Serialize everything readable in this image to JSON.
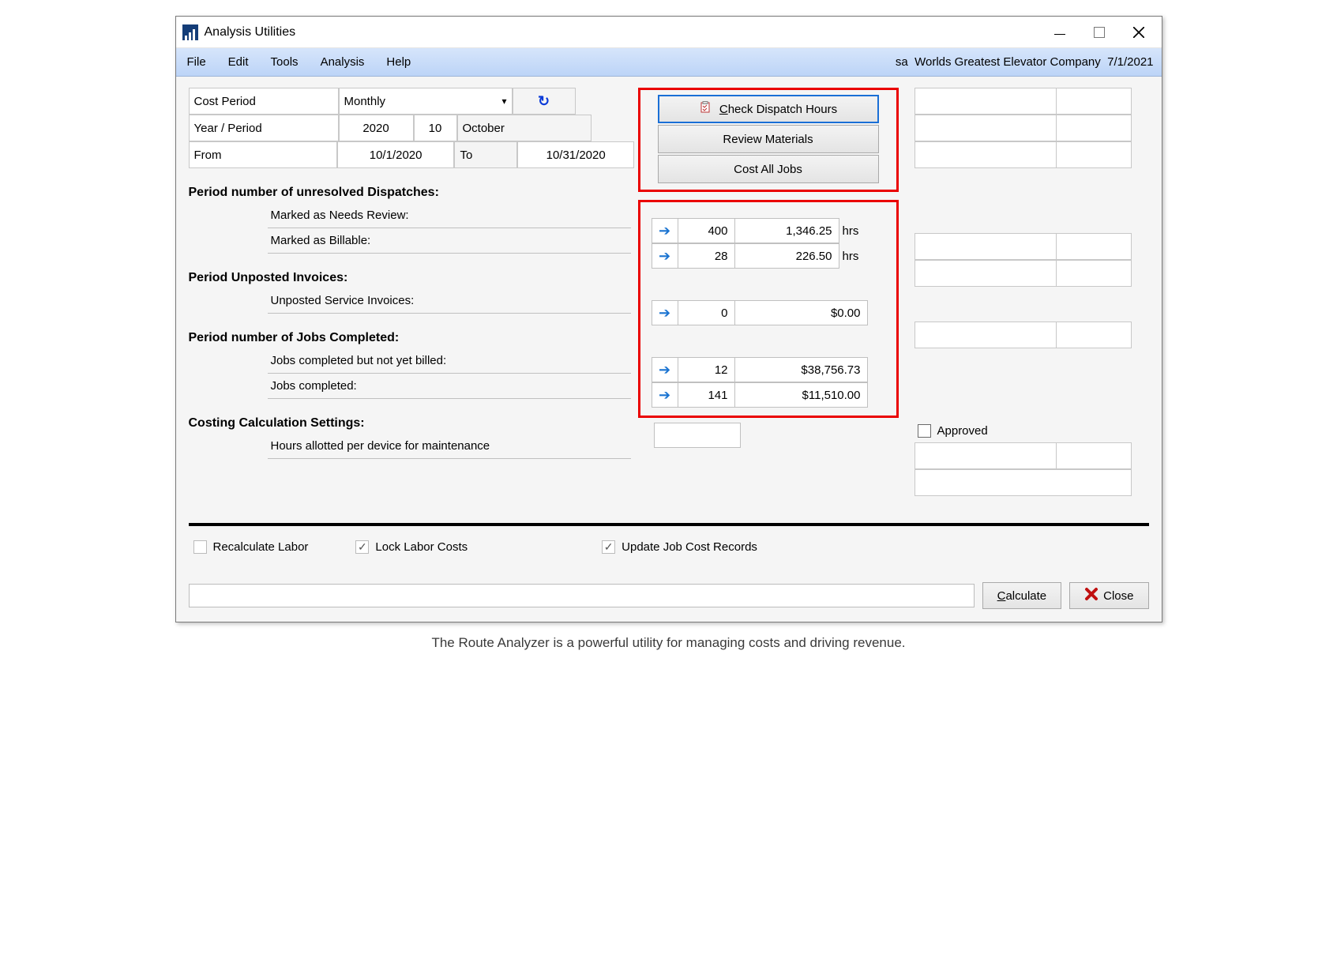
{
  "window": {
    "title": "Analysis Utilities"
  },
  "menu": {
    "file": "File",
    "edit": "Edit",
    "tools": "Tools",
    "analysis": "Analysis",
    "help": "Help"
  },
  "status": {
    "user": "sa",
    "company": "Worlds Greatest Elevator Company",
    "date": "7/1/2021"
  },
  "period": {
    "cost_period_label": "Cost Period",
    "cost_period_value": "Monthly",
    "year_period_label": "Year / Period",
    "year": "2020",
    "period_no": "10",
    "month": "October",
    "from_label": "From",
    "from_date": "10/1/2020",
    "to_label": "To",
    "to_date": "10/31/2020"
  },
  "actions": {
    "check_dispatch_prefix": "C",
    "check_dispatch_rest": "heck Dispatch Hours",
    "review_materials": "Review Materials",
    "cost_all_jobs": "Cost All Jobs"
  },
  "sections": {
    "dispatches_head": "Period number of unresolved Dispatches:",
    "dispatches_needs_review": "Marked as Needs Review:",
    "dispatches_billable": "Marked as Billable:",
    "unposted_head": "Period Unposted Invoices:",
    "unposted_service": "Unposted Service Invoices:",
    "jobs_head": "Period number of Jobs Completed:",
    "jobs_unbilled": "Jobs completed but not yet billed:",
    "jobs_completed": "Jobs completed:",
    "costing_head": "Costing Calculation Settings:",
    "hours_allotted": "Hours allotted per device for maintenance"
  },
  "metrics": {
    "needs_review_count": "400",
    "needs_review_hours": "1,346.25",
    "billable_count": "28",
    "billable_hours": "226.50",
    "hrs_unit": "hrs",
    "unposted_count": "0",
    "unposted_amount": "$0.00",
    "jobs_unbilled_count": "12",
    "jobs_unbilled_amount": "$38,756.73",
    "jobs_completed_count": "141",
    "jobs_completed_amount": "$11,510.00"
  },
  "approved_label": "Approved",
  "bottom": {
    "recalc_labor": "Recalculate Labor",
    "lock_labor": "Lock Labor Costs",
    "update_job_cost": "Update Job Cost Records"
  },
  "footer": {
    "calculate_prefix": "C",
    "calculate_rest": "alculate",
    "close": "Close"
  },
  "caption": "The Route Analyzer is a powerful utility for managing costs and driving revenue."
}
